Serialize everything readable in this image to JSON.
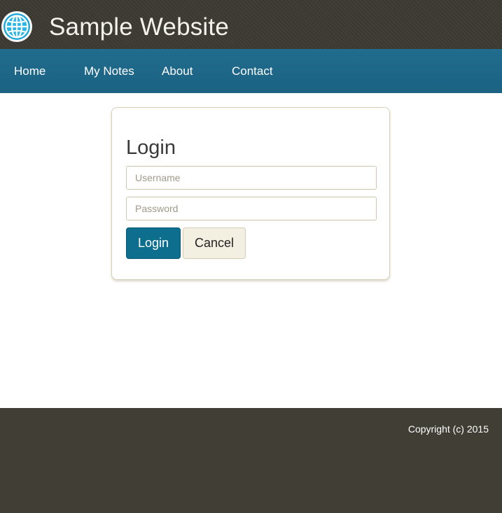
{
  "header": {
    "title": "Sample Website",
    "logo_icon": "globe-icon"
  },
  "nav": {
    "items": [
      {
        "label": "Home"
      },
      {
        "label": "My Notes"
      },
      {
        "label": "About"
      },
      {
        "label": "Contact"
      }
    ]
  },
  "login": {
    "heading": "Login",
    "username_placeholder": "Username",
    "username_value": "",
    "password_placeholder": "Password",
    "password_value": "",
    "login_label": "Login",
    "cancel_label": "Cancel"
  },
  "footer": {
    "copyright": "Copyright (c) 2015"
  },
  "colors": {
    "header_bg": "#3d3a34",
    "nav_bg": "#1e6788",
    "primary_button": "#0e6e8e",
    "secondary_button": "#f3efe1",
    "footer_bg": "#413e36"
  }
}
